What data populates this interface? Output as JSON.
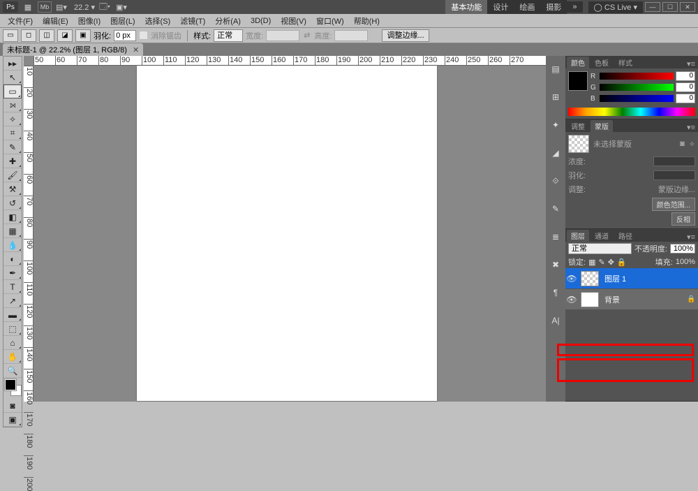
{
  "app": {
    "logo": "Ps",
    "mb": "Mb",
    "zoom": "22.2",
    "cslive": "CS Live"
  },
  "modes": [
    "基本功能",
    "设计",
    "绘画",
    "摄影",
    "»"
  ],
  "menu": [
    "文件(F)",
    "编辑(E)",
    "图像(I)",
    "图层(L)",
    "选择(S)",
    "滤镜(T)",
    "分析(A)",
    "3D(D)",
    "视图(V)",
    "窗口(W)",
    "帮助(H)"
  ],
  "opt": {
    "feather_lbl": "羽化:",
    "feather_val": "0 px",
    "antialias": "消除锯齿",
    "style_lbl": "样式:",
    "style_val": "正常",
    "w_lbl": "宽度:",
    "h_lbl": "高度:",
    "refine": "调整边缘..."
  },
  "tab": {
    "title": "未标题-1 @ 22.2% (图层 1, RGB/8)"
  },
  "ruler_h": [
    "50",
    "60",
    "70",
    "80",
    "90",
    "100",
    "110",
    "120",
    "130",
    "140",
    "150",
    "160",
    "170",
    "180",
    "190",
    "200",
    "210",
    "220",
    "230",
    "240",
    "250",
    "260",
    "270"
  ],
  "ruler_v": [
    "10",
    "20",
    "30",
    "40",
    "50",
    "60",
    "70",
    "80",
    "90",
    "100",
    "110",
    "120",
    "130",
    "140",
    "150",
    "160",
    "170",
    "180",
    "190",
    "200"
  ],
  "color": {
    "tabs": [
      "颜色",
      "色板",
      "样式"
    ],
    "r": "0",
    "g": "0",
    "b": "0",
    "r_lbl": "R",
    "g_lbl": "G",
    "b_lbl": "B"
  },
  "mask": {
    "tabs": [
      "调整",
      "蒙版"
    ],
    "none": "未选择蒙版",
    "density_lbl": "浓度:",
    "feather_lbl": "羽化:",
    "refine_lbl": "调整:",
    "btn1": "蒙版边缘...",
    "btn2": "颜色范围...",
    "btn3": "反相"
  },
  "layers": {
    "tabs": [
      "图层",
      "通道",
      "路径"
    ],
    "blend": "正常",
    "opacity_lbl": "不透明度:",
    "opacity_val": "100%",
    "lock_lbl": "锁定:",
    "fill_lbl": "填充:",
    "fill_val": "100%",
    "layer1": "图层 1",
    "bg": "背景"
  }
}
